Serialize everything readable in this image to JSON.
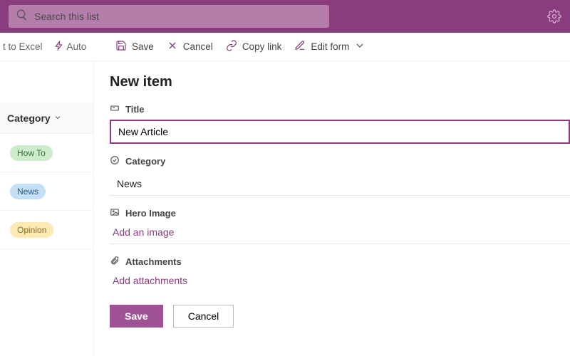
{
  "header": {
    "search_placeholder": "Search this list"
  },
  "command_bar": {
    "left_partial_1": "t to Excel",
    "left_partial_2": "Auto",
    "save": "Save",
    "cancel": "Cancel",
    "copy_link": "Copy link",
    "edit_form": "Edit form"
  },
  "column_header": "Category",
  "rows": [
    {
      "label": "How To"
    },
    {
      "label": "News"
    },
    {
      "label": "Opinion"
    }
  ],
  "form": {
    "title": "New item",
    "fields": {
      "title_label": "Title",
      "title_value": "New Article",
      "category_label": "Category",
      "category_value": "News",
      "hero_label": "Hero Image",
      "hero_action": "Add an image",
      "attach_label": "Attachments",
      "attach_action": "Add attachments"
    },
    "buttons": {
      "save": "Save",
      "cancel": "Cancel"
    }
  }
}
